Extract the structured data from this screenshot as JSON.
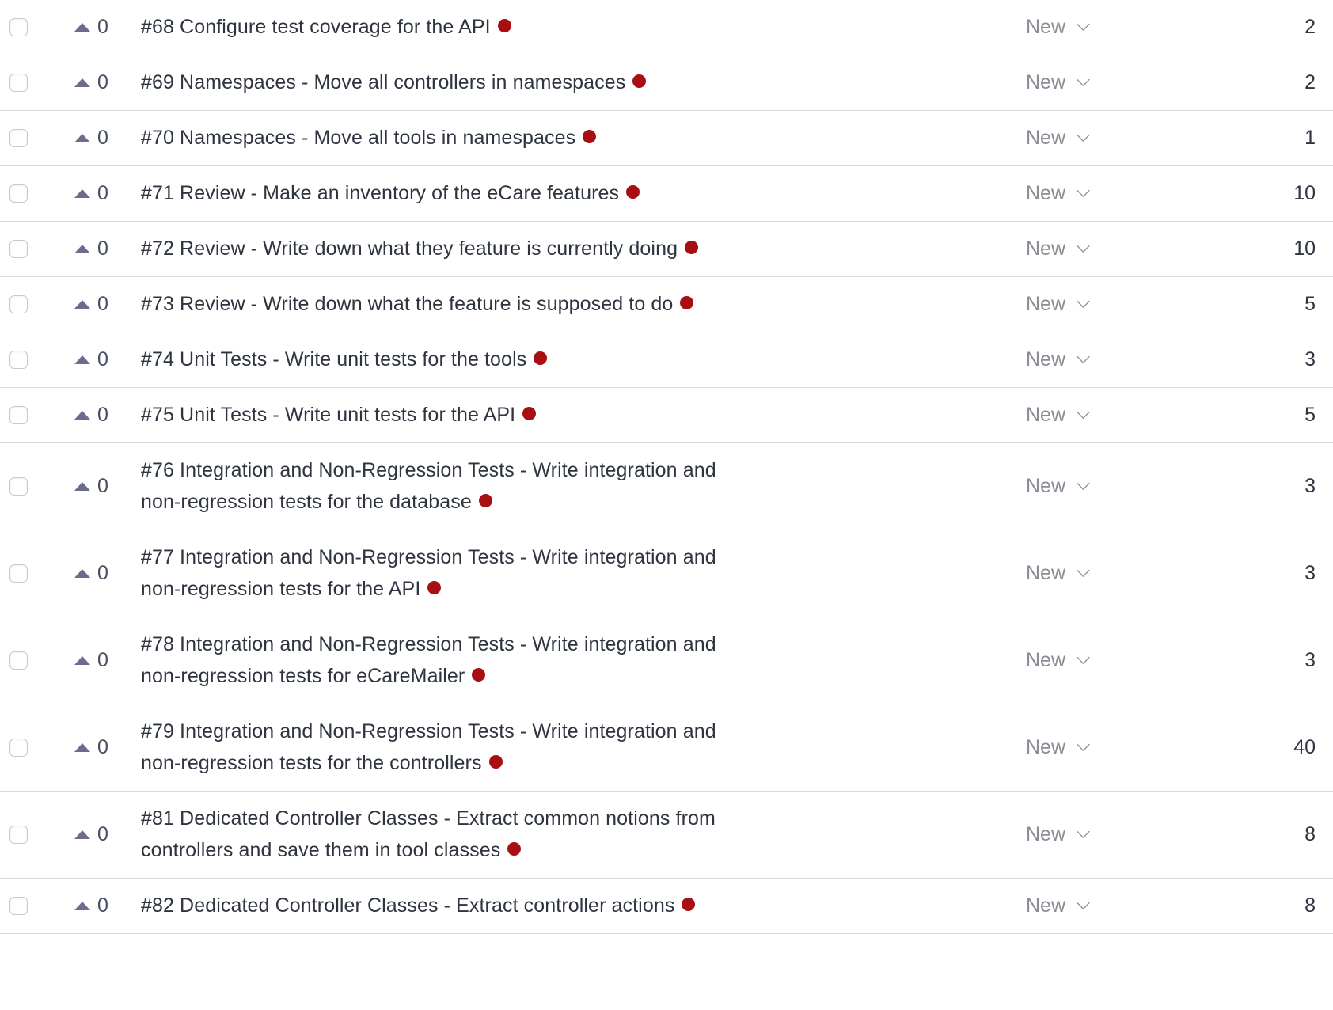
{
  "theme": {
    "row_divider_color": "#d5dae0",
    "title_text_color": "#2e3440",
    "status_text_color": "#8b8d96",
    "vote_arrow_color": "#6b6d8f",
    "vote_count_color": "#4a4e63",
    "priority_dot_color": "#a80f12",
    "background_color": "#ffffff"
  },
  "icons": {
    "checkbox": "checkbox-unchecked-icon",
    "vote": "vote-up-triangle-icon",
    "status_chevron": "chevron-down-icon",
    "priority": "priority-dot-icon"
  },
  "issues": [
    {
      "id": "#68",
      "votes": "0",
      "title": "#68 Configure test coverage for the API",
      "status": "New",
      "count": "2",
      "multiline": false
    },
    {
      "id": "#69",
      "votes": "0",
      "title": "#69 Namespaces - Move all controllers in namespaces",
      "status": "New",
      "count": "2",
      "multiline": false
    },
    {
      "id": "#70",
      "votes": "0",
      "title": "#70 Namespaces - Move all tools in namespaces",
      "status": "New",
      "count": "1",
      "multiline": false
    },
    {
      "id": "#71",
      "votes": "0",
      "title": "#71 Review - Make an inventory of the eCare features",
      "status": "New",
      "count": "10",
      "multiline": false
    },
    {
      "id": "#72",
      "votes": "0",
      "title": "#72 Review - Write down what they feature is currently doing",
      "status": "New",
      "count": "10",
      "multiline": false
    },
    {
      "id": "#73",
      "votes": "0",
      "title": "#73 Review - Write down what the feature is supposed to do",
      "status": "New",
      "count": "5",
      "multiline": false
    },
    {
      "id": "#74",
      "votes": "0",
      "title": "#74 Unit Tests - Write unit tests for the tools",
      "status": "New",
      "count": "3",
      "multiline": false
    },
    {
      "id": "#75",
      "votes": "0",
      "title": "#75 Unit Tests - Write unit tests for the API",
      "status": "New",
      "count": "5",
      "multiline": false
    },
    {
      "id": "#76",
      "votes": "0",
      "title": "#76 Integration and Non-Regression Tests - Write integration and non-regression tests for the database",
      "status": "New",
      "count": "3",
      "multiline": true
    },
    {
      "id": "#77",
      "votes": "0",
      "title": "#77 Integration and Non-Regression Tests - Write integration and non-regression tests for the API",
      "status": "New",
      "count": "3",
      "multiline": true
    },
    {
      "id": "#78",
      "votes": "0",
      "title": "#78 Integration and Non-Regression Tests - Write integration and non-regression tests for eCareMailer",
      "status": "New",
      "count": "3",
      "multiline": true
    },
    {
      "id": "#79",
      "votes": "0",
      "title": "#79 Integration and Non-Regression Tests - Write integration and non-regression tests for the controllers",
      "status": "New",
      "count": "40",
      "multiline": true
    },
    {
      "id": "#81",
      "votes": "0",
      "title": "#81 Dedicated Controller Classes - Extract common notions from controllers and save them in tool classes",
      "status": "New",
      "count": "8",
      "multiline": true
    },
    {
      "id": "#82",
      "votes": "0",
      "title": "#82 Dedicated Controller Classes - Extract controller actions",
      "status": "New",
      "count": "8",
      "multiline": false
    }
  ]
}
